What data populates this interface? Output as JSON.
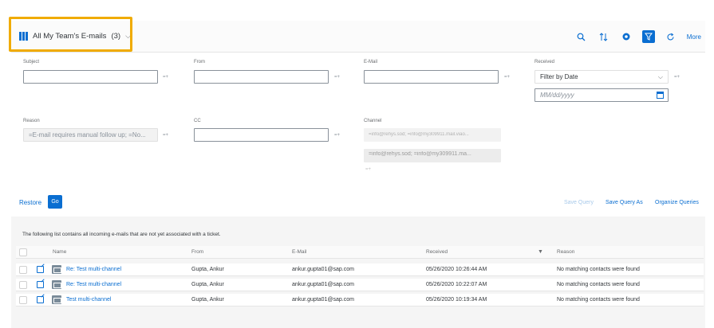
{
  "header": {
    "title": "All My Team's E-mails",
    "count": "(3)",
    "more_label": "More"
  },
  "icons": {
    "title": "table-view-icon",
    "search": "search-icon",
    "sort": "sort-icon",
    "settings": "settings-icon",
    "filter": "filter-icon",
    "refresh": "refresh-icon"
  },
  "filters": {
    "subject": {
      "label": "Subject",
      "value": ""
    },
    "from": {
      "label": "From",
      "value": ""
    },
    "email": {
      "label": "E-Mail",
      "value": ""
    },
    "received": {
      "label": "Received",
      "select_value": "Filter by Date",
      "date_placeholder": "MM/dd/yyyy"
    },
    "reason": {
      "label": "Reason",
      "value": "=E-mail requires manual follow up; =No..."
    },
    "cc": {
      "label": "CC",
      "value": ""
    },
    "channel": {
      "label": "Channel",
      "value": "=info@rehys.sod; =info@my309911.mail.viao...",
      "token": "=info@rehys.sod; =info@my309911.ma..."
    },
    "value_help": "=+"
  },
  "footer": {
    "restore": "Restore",
    "go": "Go",
    "save_query": "Save Query",
    "save_query_as": "Save Query As",
    "organize_queries": "Organize Queries"
  },
  "table": {
    "info": "The following list contains all incoming e-mails that are not yet associated with a ticket.",
    "columns": {
      "name": "Name",
      "from": "From",
      "email": "E-Mail",
      "received": "Received",
      "reason": "Reason"
    },
    "rows": [
      {
        "name": "Re: Test multi-channel",
        "from": "Gupta, Ankur",
        "email": "ankur.gupta01@sap.com",
        "received": "05/26/2020 10:26:44 AM",
        "reason": "No matching contacts were found"
      },
      {
        "name": "Re: Test multi-channel",
        "from": "Gupta, Ankur",
        "email": "ankur.gupta01@sap.com",
        "received": "05/26/2020 10:22:07 AM",
        "reason": "No matching contacts were found"
      },
      {
        "name": "Test multi-channel",
        "from": "Gupta, Ankur",
        "email": "ankur.gupta01@sap.com",
        "received": "05/26/2020 10:19:34 AM",
        "reason": "No matching contacts were found"
      }
    ]
  },
  "colors": {
    "accent": "#0a6ed1",
    "highlight": "#f0ab00"
  }
}
